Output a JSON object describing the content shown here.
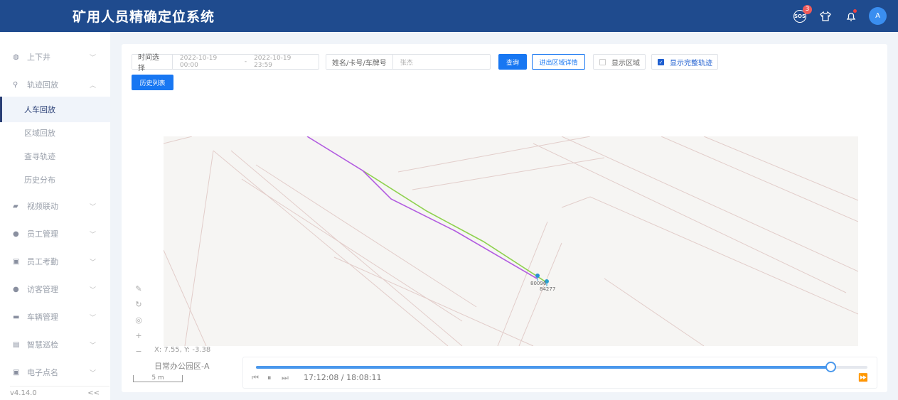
{
  "header": {
    "title": "矿用人员精确定位系统",
    "sos_label": "SOS",
    "sos_count": "3",
    "avatar": "A",
    "icons": [
      "sos-icon",
      "shirt-icon",
      "bell-icon"
    ]
  },
  "sidebar": {
    "items": [
      {
        "label": "上下井",
        "icon": "globe-icon",
        "expanded": false
      },
      {
        "label": "轨迹回放",
        "icon": "location-icon",
        "expanded": true
      },
      {
        "label": "人车回放",
        "sub": true,
        "active": true
      },
      {
        "label": "区域回放",
        "sub": true
      },
      {
        "label": "查寻轨迹",
        "sub": true
      },
      {
        "label": "历史分布",
        "sub": true
      },
      {
        "label": "视频联动",
        "icon": "camera-icon"
      },
      {
        "label": "员工管理",
        "icon": "user-icon"
      },
      {
        "label": "员工考勤",
        "icon": "calendar-icon"
      },
      {
        "label": "访客管理",
        "icon": "visitor-icon"
      },
      {
        "label": "车辆管理",
        "icon": "truck-icon"
      },
      {
        "label": "智慧巡检",
        "icon": "inspection-icon"
      },
      {
        "label": "电子点名",
        "icon": "badge-icon"
      }
    ],
    "version": "v4.14.0",
    "collapse": "<<"
  },
  "filters": {
    "time_label": "时间选择",
    "start": "2022-10-19 00:00",
    "sep": "-",
    "end": "2022-10-19 23:59",
    "name_label": "姓名/卡号/车牌号",
    "name_value": "张杰",
    "query": "查询",
    "area_detail": "进出区域详情",
    "show_area": "显示区域",
    "show_area_checked": false,
    "show_full": "显示完整轨迹",
    "show_full_checked": true,
    "history": "历史列表"
  },
  "map": {
    "markers": [
      "80096",
      "84277"
    ],
    "coord": "X:  7.55,  Y:  -3.38",
    "area": "日常办公园区-A",
    "scale": "5 m",
    "track_colors": {
      "purple": "#b25ce0",
      "green": "#8fd14f"
    }
  },
  "player": {
    "time": "17:12:08 / 18:08:11",
    "progress": 0.94
  }
}
